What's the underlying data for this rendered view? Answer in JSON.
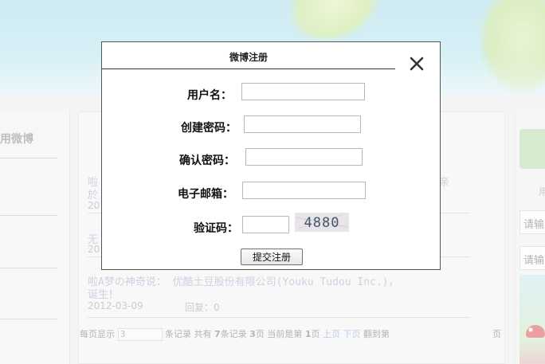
{
  "background": {
    "left_title": "用微博",
    "posts": [
      {
        "line1": "啦",
        "line1b": "於",
        "meta": "20"
      },
      {
        "line1": "无",
        "meta": "20"
      }
    ],
    "post3": {
      "text": "啦A梦の神奇说： 优酷土豆股份有限公司(Youku Tudou Inc.)，",
      "text2": "诞生！",
      "date": "2012-03-09",
      "reply": "回复：0"
    },
    "right_fragment": "亲",
    "pager": {
      "per_page_label": "每页显示",
      "per_page_value": "3",
      "records_label": "条记录 共有",
      "total": "7",
      "total_suffix": "条记录",
      "pages": "3",
      "pages_suffix": "页 当前是第",
      "current": "1",
      "current_suffix": "页",
      "prev": "上页",
      "next": "下页",
      "jump": "翻到第",
      "end": "页"
    },
    "right": {
      "text": "用",
      "input1": "请输",
      "input2": "请输"
    }
  },
  "dialog": {
    "title": "微博注册",
    "fields": {
      "username_label": "用户名：",
      "password_label": "创建密码：",
      "confirm_label": "确认密码：",
      "email_label": "电子邮箱：",
      "captcha_label": "验证码："
    },
    "captcha_text": "4880",
    "submit_label": "提交注册"
  }
}
